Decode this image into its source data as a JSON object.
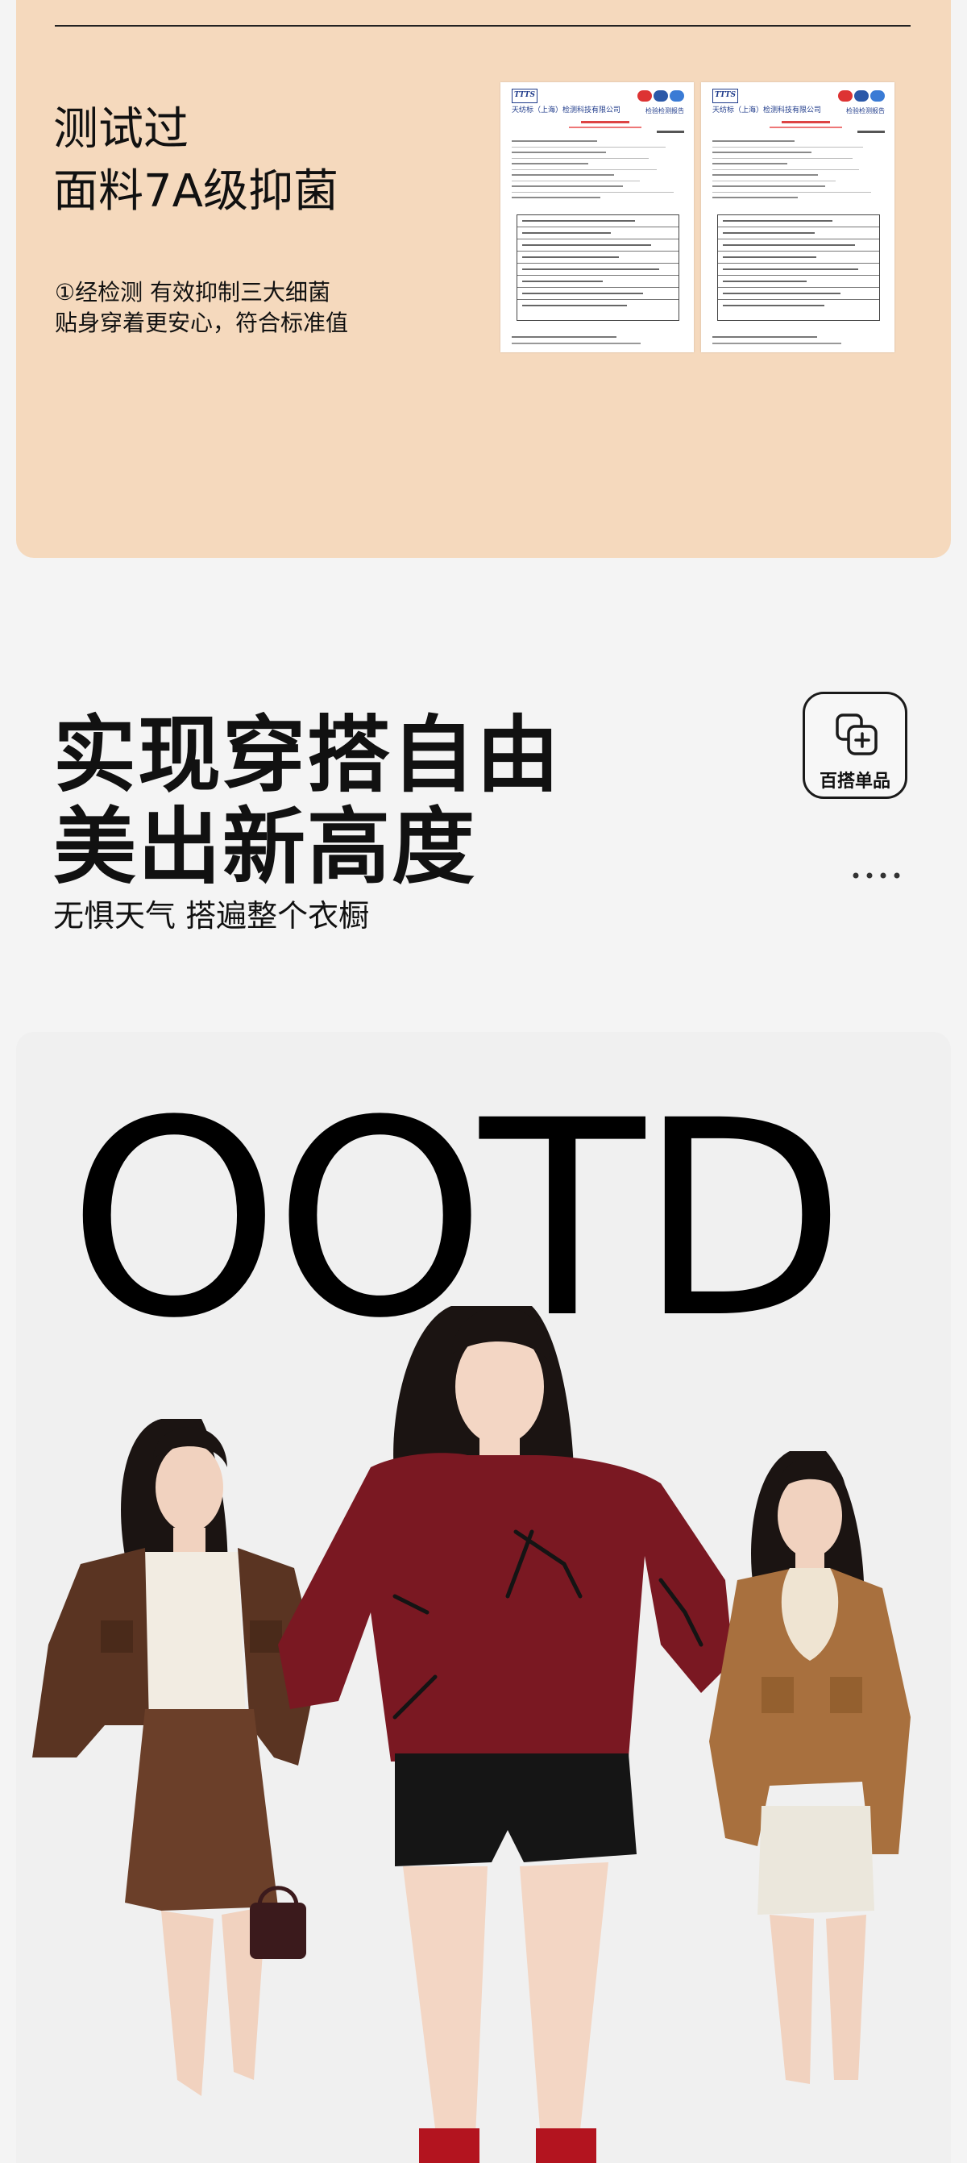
{
  "materials": {
    "title_line1": "测试过",
    "title_line2": "面料7A级抑菌",
    "desc_line1": "①经检测 有效抑制三大细菌",
    "desc_line2": "贴身穿着更安心，符合标准值",
    "report": {
      "logo": "TTTS",
      "org": "天纺标（上海）检测科技有限公司",
      "doc_title": "检验检测报告"
    }
  },
  "styling": {
    "headline_line1": "实现穿搭自由",
    "headline_line2": "美出新高度",
    "subheadline": "无惧天气 搭遍整个衣橱",
    "badge_label": "百搭单品",
    "badge_icon": "layers-plus-icon",
    "more_icon": "more-dots-icon"
  },
  "ootd": {
    "word": "OOTD"
  },
  "colors": {
    "peach_bg": "#f5d9bd",
    "page_bg": "#f4f4f4",
    "card_bg": "#f0f0f0",
    "burgundy": "#7a1822",
    "brown": "#5a3422",
    "camel": "#a8703e"
  }
}
